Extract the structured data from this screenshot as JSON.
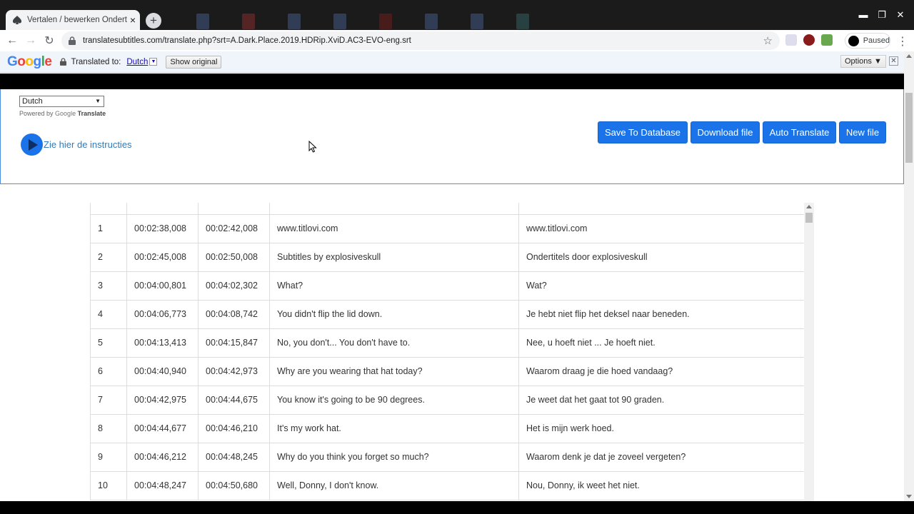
{
  "browser": {
    "tab_title": "Vertalen / bewerken Ondertitelin",
    "new_tab": "+",
    "url": "translatesubtitles.com/translate.php?srt=A.Dark.Place.2019.HDRip.XviD.AC3-EVO-eng.srt",
    "profile_status": "Paused",
    "window_controls": {
      "minimize": "▬",
      "restore": "❐",
      "close": "✕"
    }
  },
  "translate_bar": {
    "logo": [
      "G",
      "o",
      "o",
      "g",
      "l",
      "e"
    ],
    "translated_to_label": "Translated to:",
    "language": "Dutch",
    "show_original": "Show original",
    "options": "Options ▼",
    "close": "✕"
  },
  "page": {
    "language_select": "Dutch",
    "powered_by": "Powered by",
    "powered_google": "Google",
    "powered_translate": "Translate",
    "instructions_link": "Zie hier de instructies",
    "buttons": {
      "save": "Save To Database",
      "download": "Download file",
      "auto": "Auto Translate",
      "new": "New file"
    }
  },
  "subtitles": [
    {
      "n": "1",
      "start": "00:02:38,008",
      "end": "00:02:42,008",
      "original": "www.titlovi.com",
      "translation": "www.titlovi.com"
    },
    {
      "n": "2",
      "start": "00:02:45,008",
      "end": "00:02:50,008",
      "original": "Subtitles by explosiveskull",
      "translation": "Ondertitels door explosiveskull"
    },
    {
      "n": "3",
      "start": "00:04:00,801",
      "end": "00:04:02,302",
      "original": "What?",
      "translation": "Wat?"
    },
    {
      "n": "4",
      "start": "00:04:06,773",
      "end": "00:04:08,742",
      "original": "You didn't flip the lid down.",
      "translation": "Je hebt niet flip het deksel naar beneden."
    },
    {
      "n": "5",
      "start": "00:04:13,413",
      "end": "00:04:15,847",
      "original": "No, you don't... You don't have to.",
      "translation": "Nee, u hoeft niet ... Je hoeft niet."
    },
    {
      "n": "6",
      "start": "00:04:40,940",
      "end": "00:04:42,973",
      "original": "Why are you wearing that hat today?",
      "translation": "Waarom draag je die hoed vandaag?"
    },
    {
      "n": "7",
      "start": "00:04:42,975",
      "end": "00:04:44,675",
      "original": "You know it's going to be 90 degrees.",
      "translation": "Je weet dat het gaat tot 90 graden."
    },
    {
      "n": "8",
      "start": "00:04:44,677",
      "end": "00:04:46,210",
      "original": "It's my work hat.",
      "translation": "Het is mijn werk hoed."
    },
    {
      "n": "9",
      "start": "00:04:46,212",
      "end": "00:04:48,245",
      "original": "Why do you think you forget so much?",
      "translation": "Waarom denk je dat je zoveel vergeten?"
    },
    {
      "n": "10",
      "start": "00:04:48,247",
      "end": "00:04:50,680",
      "original": "Well, Donny, I don't know.",
      "translation": "Nou, Donny, ik weet het niet."
    }
  ]
}
